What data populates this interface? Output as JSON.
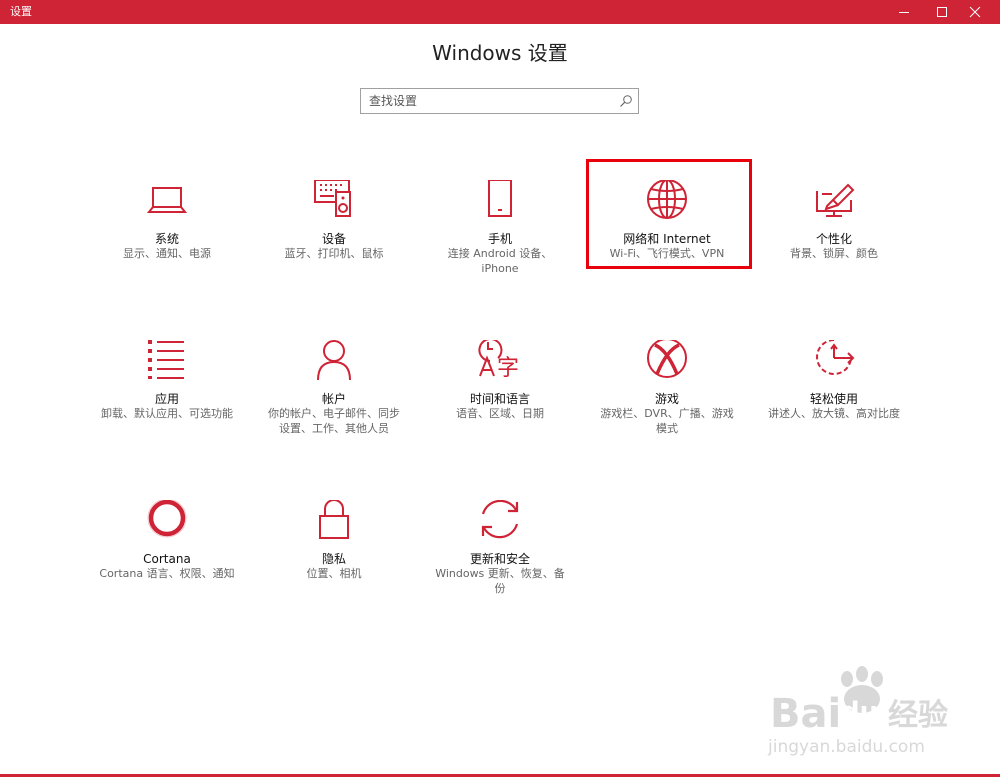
{
  "window": {
    "title": "设置",
    "accent": "#cf2336"
  },
  "header": {
    "title": "Windows 设置"
  },
  "search": {
    "placeholder": "查找设置"
  },
  "tiles": [
    {
      "icon": "laptop-icon",
      "name": "系统",
      "desc": "显示、通知、电源"
    },
    {
      "icon": "keyboard-speaker-icon",
      "name": "设备",
      "desc": "蓝牙、打印机、鼠标"
    },
    {
      "icon": "phone-icon",
      "name": "手机",
      "desc": "连接 Android 设备、iPhone"
    },
    {
      "icon": "globe-icon",
      "name": "网络和 Internet",
      "desc": "Wi-Fi、飞行模式、VPN"
    },
    {
      "icon": "paint-brush-icon",
      "name": "个性化",
      "desc": "背景、锁屏、颜色"
    },
    {
      "icon": "apps-list-icon",
      "name": "应用",
      "desc": "卸载、默认应用、可选功能"
    },
    {
      "icon": "person-icon",
      "name": "帐户",
      "desc": "你的帐户、电子邮件、同步设置、工作、其他人员"
    },
    {
      "icon": "time-language-icon",
      "name": "时间和语言",
      "desc": "语音、区域、日期"
    },
    {
      "icon": "xbox-icon",
      "name": "游戏",
      "desc": "游戏栏、DVR、广播、游戏模式"
    },
    {
      "icon": "ease-of-access-icon",
      "name": "轻松使用",
      "desc": "讲述人、放大镜、高对比度"
    },
    {
      "icon": "cortana-icon",
      "name": "Cortana",
      "desc": "Cortana 语言、权限、通知"
    },
    {
      "icon": "lock-icon",
      "name": "隐私",
      "desc": "位置、相机"
    },
    {
      "icon": "sync-icon",
      "name": "更新和安全",
      "desc": "Windows 更新、恢复、备份"
    }
  ],
  "watermark": {
    "brand_left": "Bai",
    "brand_mid": "du",
    "brand_cn": "经验",
    "url": "jingyan.baidu.com"
  }
}
